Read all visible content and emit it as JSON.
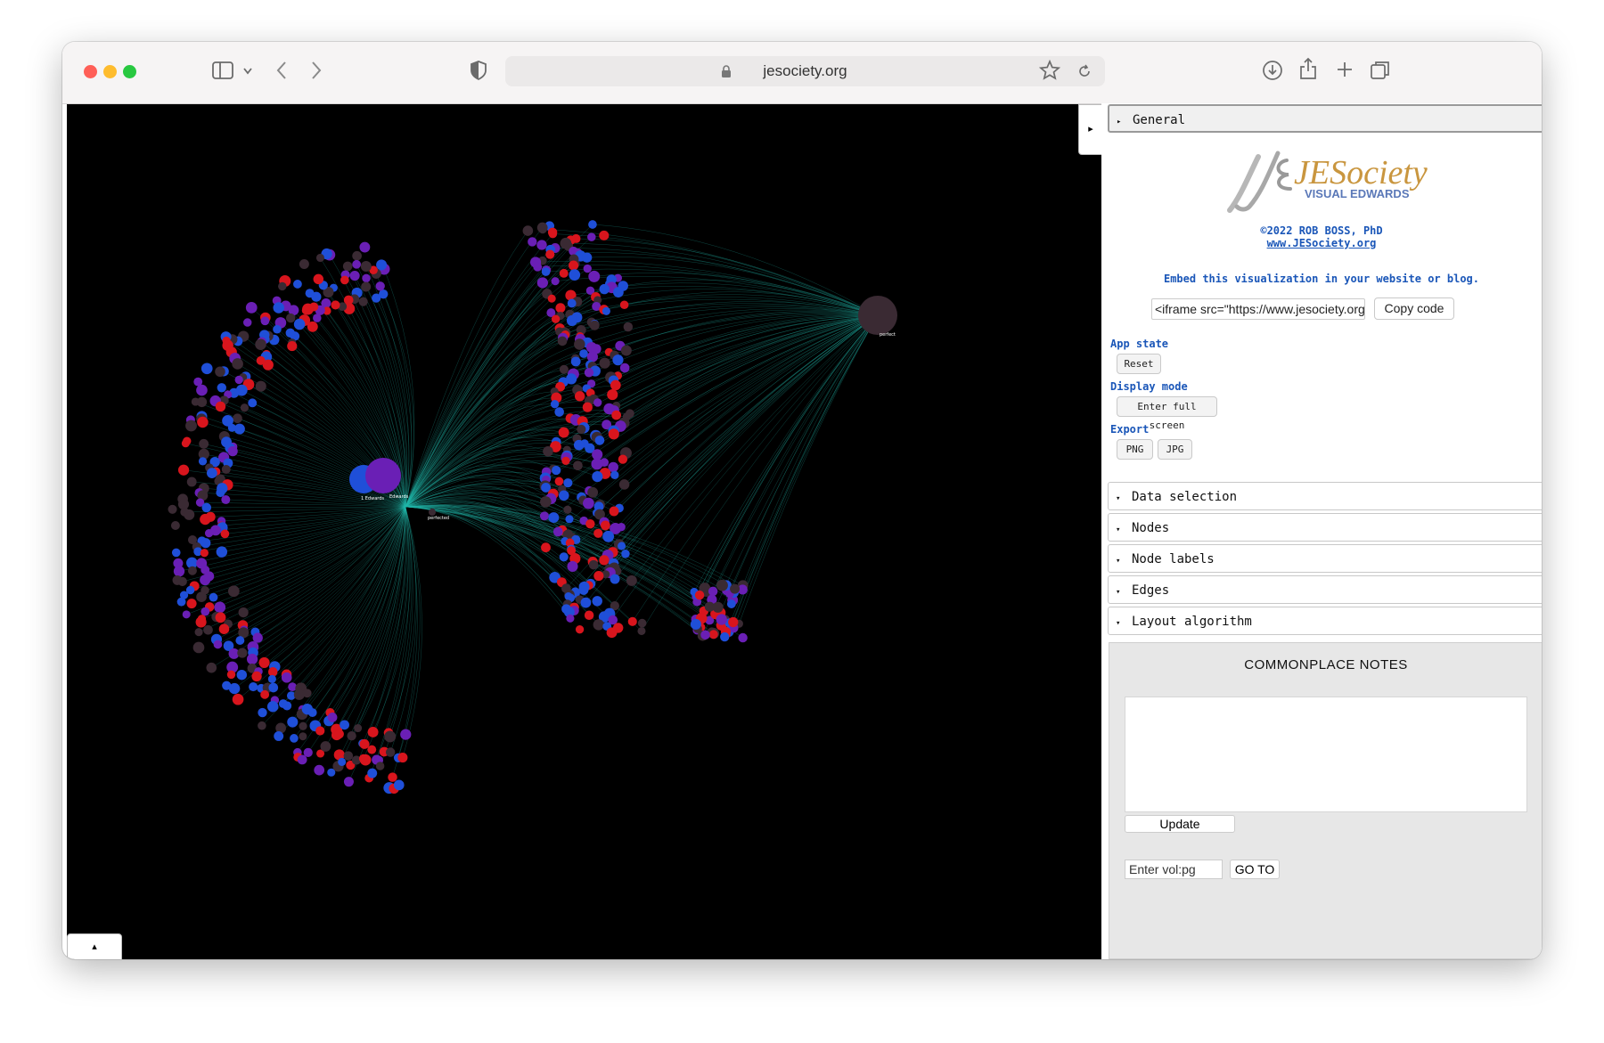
{
  "browser": {
    "url": "jesociety.org",
    "colors": {
      "close": "#ff5f57",
      "minimize": "#febc2e",
      "zoom": "#28c840"
    },
    "icons": [
      "sidebar-icon",
      "chevron-down-icon",
      "back-icon",
      "forward-icon",
      "shield-icon",
      "lock-icon",
      "reload-icon",
      "star-icon",
      "download-icon",
      "share-icon",
      "plus-icon",
      "tabs-icon"
    ]
  },
  "graph": {
    "background": "#000000",
    "edge_color": "#1fb5a8",
    "hub_labels": {
      "left_hub": "1 Edwards",
      "center_hub": "Edwards",
      "small_hub": "perfected",
      "right_hub": "perfect"
    },
    "node_colors": {
      "blue": "#1f4fd8",
      "red": "#d8151d",
      "purple": "#6a1fb5",
      "dark": "#3a2a33"
    },
    "collapse_label": "▸",
    "expand_label": "▴"
  },
  "panel": {
    "general": "General",
    "logo": {
      "main": "JESociety",
      "sub": "VISUAL EDWARDS"
    },
    "copyright": "©2022 ROB BOSS, PhD",
    "website": "www.JESociety.org",
    "embed_text": "Embed this visualization in your website or blog.",
    "embed_code": "<iframe src=\"https://www.jesociety.org/i",
    "copy_label": "Copy code",
    "app_state": {
      "label": "App state",
      "reset": "Reset"
    },
    "display_mode": {
      "label": "Display mode",
      "button": "Enter full screen"
    },
    "export": {
      "label": "Export",
      "png": "PNG",
      "jpg": "JPG"
    },
    "sections": [
      "Data selection",
      "Nodes",
      "Node labels",
      "Edges",
      "Layout algorithm"
    ],
    "notes": {
      "title": "COMMONPLACE NOTES",
      "update": "Update",
      "volpg_placeholder": "Enter vol:pg",
      "goto": "GO TO"
    }
  }
}
